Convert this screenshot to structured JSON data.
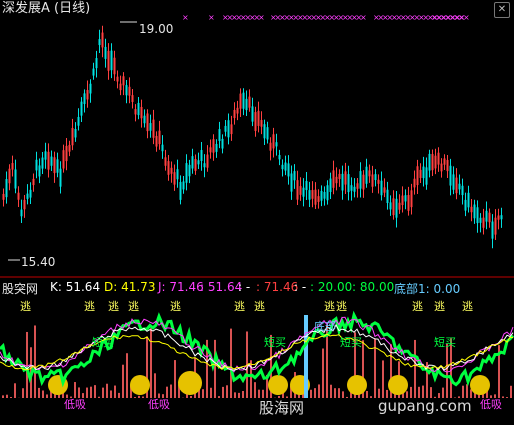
{
  "window": {
    "title": "深发展A (日线)"
  },
  "price_panel": {
    "high_label": "19.00",
    "low_label": "15.40"
  },
  "indicator_header": {
    "name": "股突网",
    "k": "K: 51.64",
    "d": "D: 41.73",
    "j": "J: 71.46",
    "v1": ": 51.64",
    "v2": ": -",
    "v3": ": 71.46",
    "v4": ": -",
    "v5": ": 20.00",
    "v6": ": 80.00",
    "bottom": "底部1: 0.00"
  },
  "signals": {
    "escape": "逃",
    "short_buy": "短买",
    "low_suck": "低吸",
    "bottom": "底部"
  },
  "watermark": {
    "site_cn": "股海网",
    "site_url": "gupang.com"
  },
  "colors": {
    "up": "#ff4040",
    "down": "#00e0e0",
    "k": "#ffffff",
    "d": "#ffff00",
    "j": "#ff40ff",
    "green": "#00ff40",
    "magenta_mark": "#ff40ff"
  }
}
